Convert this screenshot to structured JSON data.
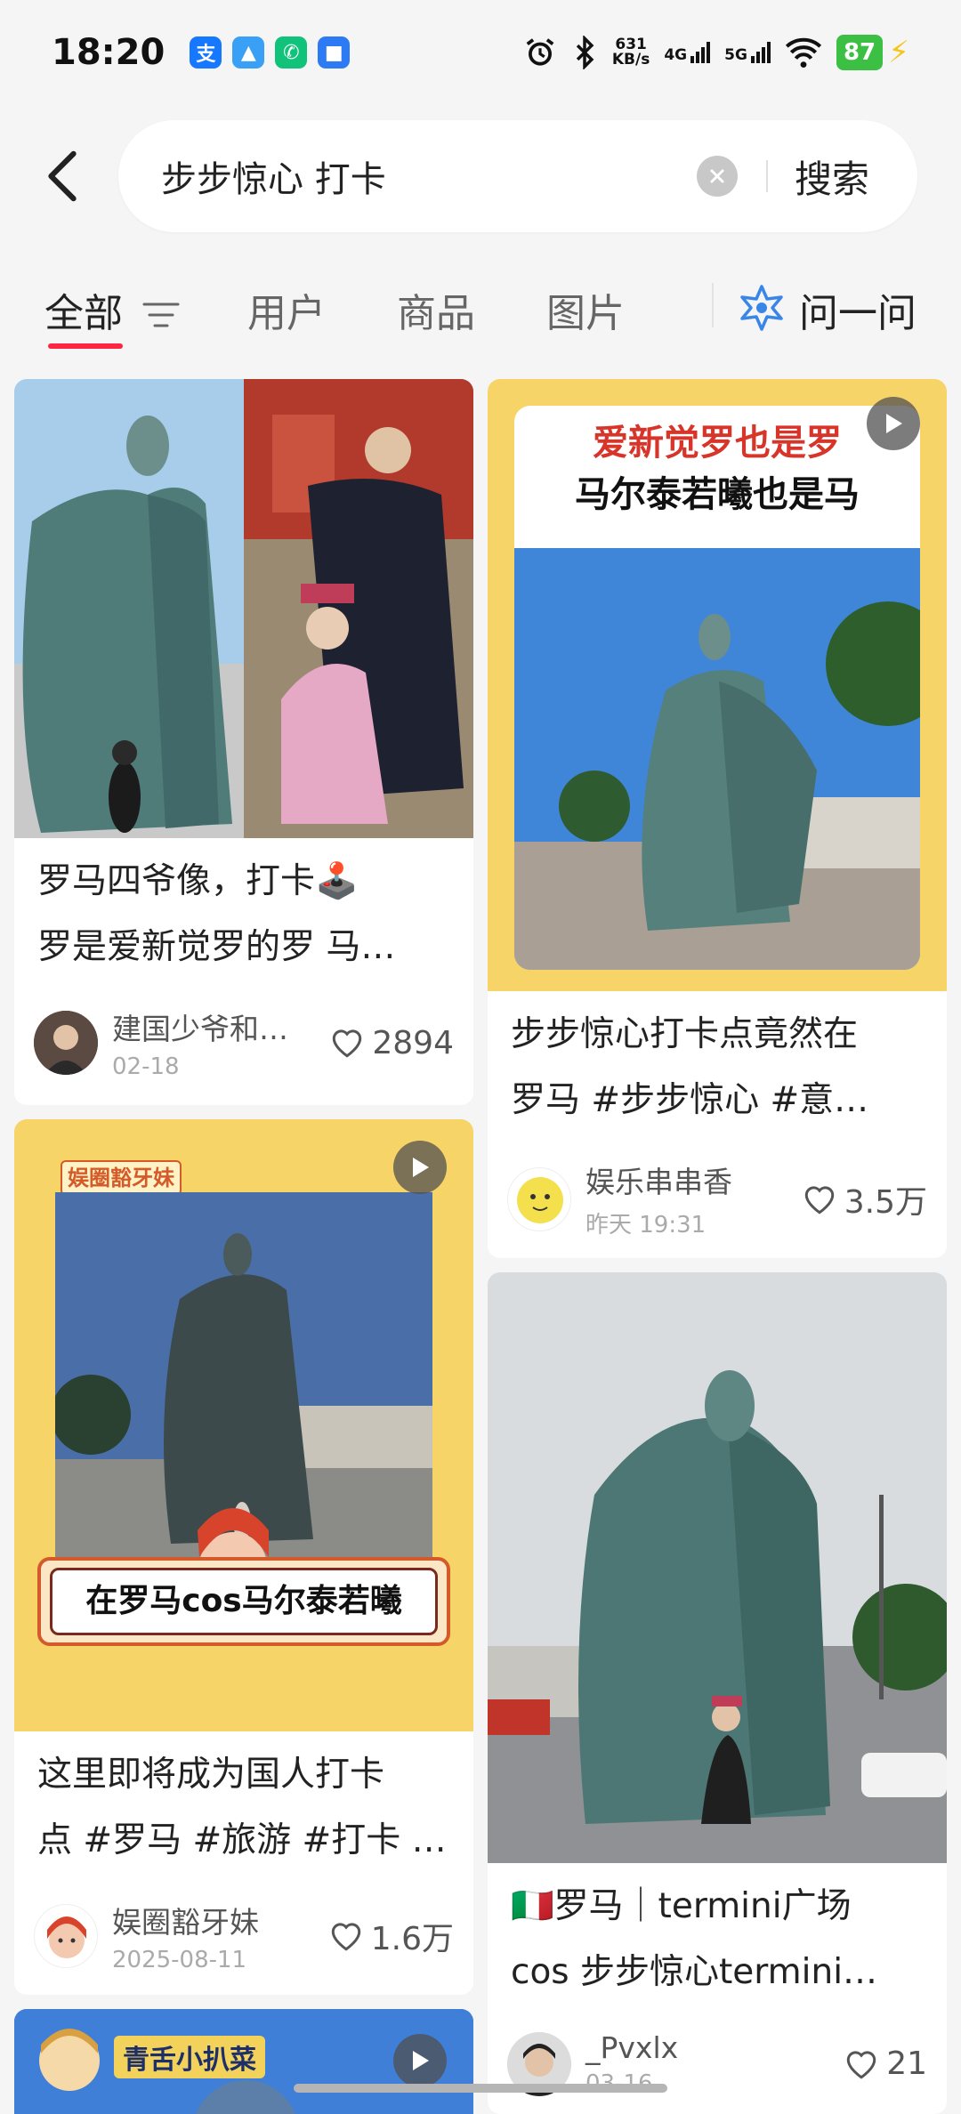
{
  "status": {
    "time": "18:20",
    "net_speed_value": "631",
    "net_speed_unit": "KB/s",
    "net_4g": "4G",
    "net_5g": "5G",
    "battery": "87"
  },
  "search": {
    "query": "步步惊心 打卡",
    "button_label": "搜索"
  },
  "tabs": [
    {
      "label": "全部"
    },
    {
      "label": "用户"
    },
    {
      "label": "商品"
    },
    {
      "label": "图片"
    },
    {
      "label": "问一问"
    }
  ],
  "cards": [
    {
      "title_line1": "罗马四爷像，打卡🕹️",
      "title_line2": "罗是爱新觉罗的罗 马…",
      "author": "建国少爷和…",
      "date": "02-18",
      "likes": "2894"
    },
    {
      "image_caption_line1": "爱新觉罗也是罗",
      "image_caption_line2": "马尔泰若曦也是马",
      "title_line1": "步步惊心打卡点竟然在",
      "title_line2": "罗马 #步步惊心  #意…",
      "author": "娱乐串串香",
      "date": "昨天 19:31",
      "likes": "3.5万"
    },
    {
      "image_tag": "娱圈豁牙妹",
      "image_banner": "在罗马cos马尔泰若曦",
      "title_line1": "这里即将成为国人打卡",
      "title_line2": "点 #罗马 #旅游 #打卡 …",
      "author": "娱圈豁牙妹",
      "date": "2025-08-11",
      "likes": "1.6万"
    },
    {
      "title_line1": "🇮🇹罗马｜termini广场",
      "title_line2": "cos 步步惊心termini…",
      "author": "_Pvxlx",
      "date": "03-16",
      "likes": "21"
    },
    {
      "image_tag": "青舌小扒菜"
    }
  ],
  "colors": {
    "accent": "#ff2442",
    "card_yellow": "#f6d467",
    "statue": "#4e7a77"
  }
}
